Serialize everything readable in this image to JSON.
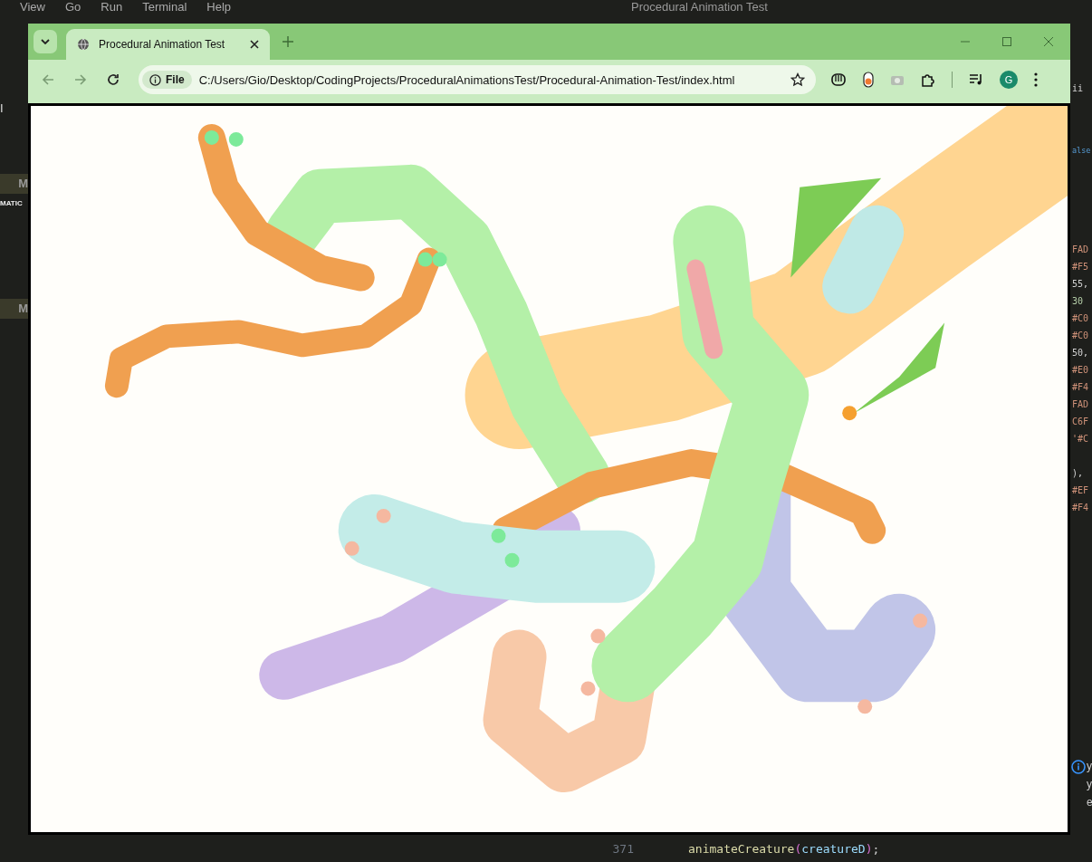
{
  "editor": {
    "menu": [
      "View",
      "Go",
      "Run",
      "Terminal",
      "Help"
    ],
    "title": "Procedural Animation Test",
    "left_fragments": [
      {
        "text": "I",
        "kind": "plain"
      },
      {
        "text": "M",
        "kind": "header"
      },
      {
        "text": "MATIC",
        "kind": "bold"
      },
      {
        "text": "M",
        "kind": "header"
      }
    ],
    "code_fragments": [
      {
        "text": "ii",
        "kind": "plain"
      },
      {
        "text": "alse",
        "kind": "keyword"
      },
      {
        "text": "FAD",
        "kind": "string"
      },
      {
        "text": "#F5",
        "kind": "string"
      },
      {
        "text": "55,",
        "kind": "plain"
      },
      {
        "text": "30",
        "kind": "number"
      },
      {
        "text": "#C0",
        "kind": "string"
      },
      {
        "text": "#C0",
        "kind": "string"
      },
      {
        "text": "50,",
        "kind": "plain"
      },
      {
        "text": "#E0",
        "kind": "string"
      },
      {
        "text": "#F4",
        "kind": "string"
      },
      {
        "text": "FAD",
        "kind": "string"
      },
      {
        "text": "C6F",
        "kind": "string"
      },
      {
        "text": "'#C",
        "kind": "string"
      },
      {
        "text": "),",
        "kind": "plain"
      },
      {
        "text": "#EF",
        "kind": "string"
      },
      {
        "text": "#F4",
        "kind": "string"
      }
    ],
    "notice_lines": [
      "y",
      "y",
      "e"
    ],
    "line_number": "371",
    "code_line": [
      {
        "text": "animateCreature",
        "kind": "function"
      },
      {
        "text": "(",
        "kind": "bracket"
      },
      {
        "text": "creatureD",
        "kind": "variable"
      },
      {
        "text": ")",
        "kind": "bracket"
      },
      {
        "text": ";",
        "kind": "plain"
      }
    ]
  },
  "browser": {
    "tab_title": "Procedural Animation Test",
    "file_chip": "File",
    "url": "C:/Users/Gio/Desktop/CodingProjects/ProceduralAnimationsTest/Procedural-Animation-Test/index.html",
    "profile_initial": "G"
  }
}
